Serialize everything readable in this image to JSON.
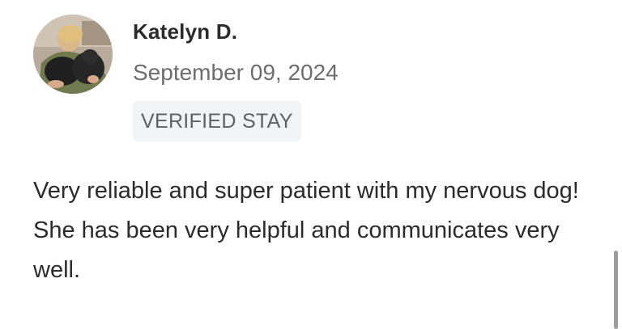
{
  "review": {
    "reviewer_name": "Katelyn D.",
    "date": "September 09, 2024",
    "badge": "VERIFIED STAY",
    "text": "Very reliable and super patient with my nervous dog! She has been very helpful and communicates very well."
  },
  "colors": {
    "badge_background": "#f2f3f5",
    "secondary_text": "#6d6d70",
    "primary_text": "#2b2b2b"
  },
  "icons": {
    "avatar": "reviewer-photo"
  }
}
